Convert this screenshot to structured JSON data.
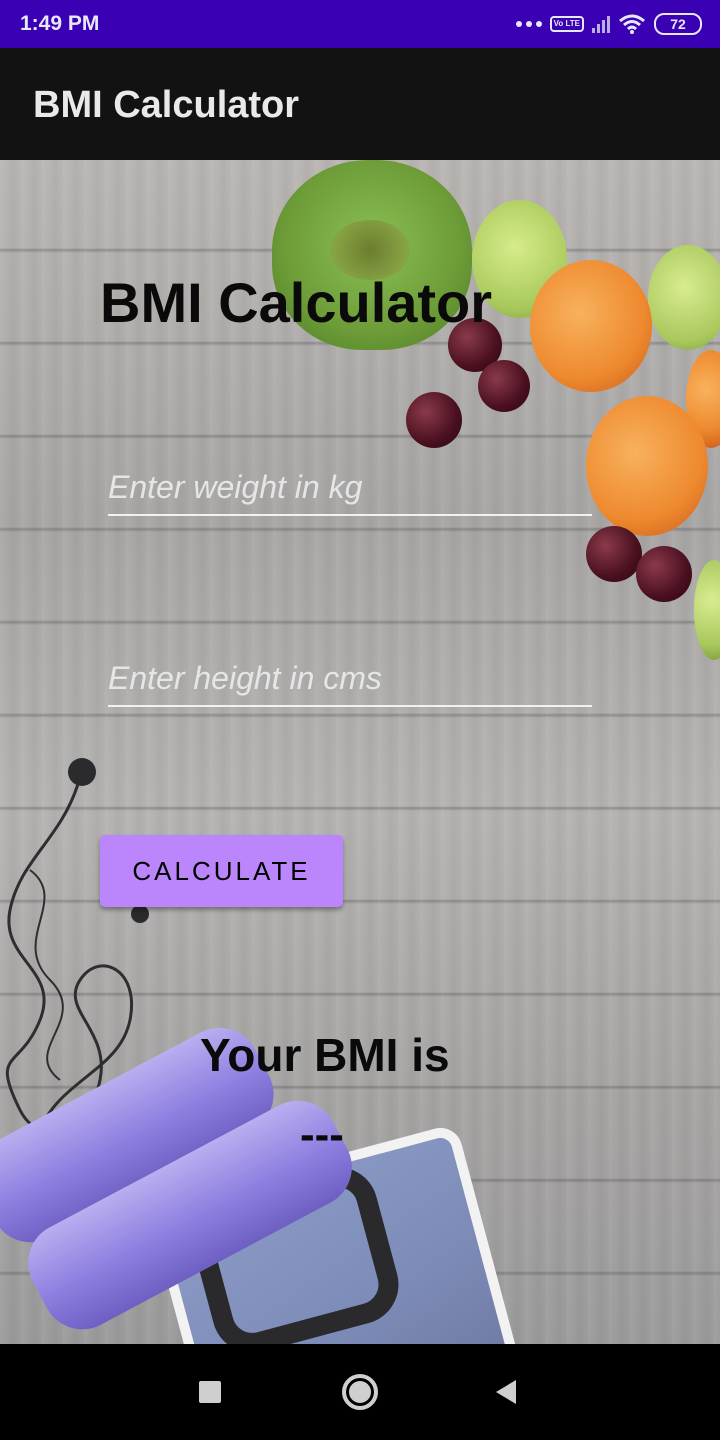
{
  "status_bar": {
    "time": "1:49 PM",
    "volte": "Vo LTE",
    "battery": "72",
    "icons": [
      "more-dots-icon",
      "volte-icon",
      "signal-icon",
      "wifi-icon",
      "battery-icon"
    ]
  },
  "app_bar": {
    "title": "BMI Calculator"
  },
  "main": {
    "title": "BMI Calculator",
    "weight_input": {
      "placeholder": "Enter weight in kg",
      "value": ""
    },
    "height_input": {
      "placeholder": "Enter height in cms",
      "value": ""
    },
    "calculate_label": "CALCULATE",
    "result_label": "Your BMI is",
    "result_value": "---"
  },
  "nav_bar": {
    "icons": [
      "recents-icon",
      "home-icon",
      "back-icon"
    ]
  },
  "colors": {
    "status_bar": "#3a00b3",
    "app_bar": "#121212",
    "button": "#bb86fc"
  }
}
